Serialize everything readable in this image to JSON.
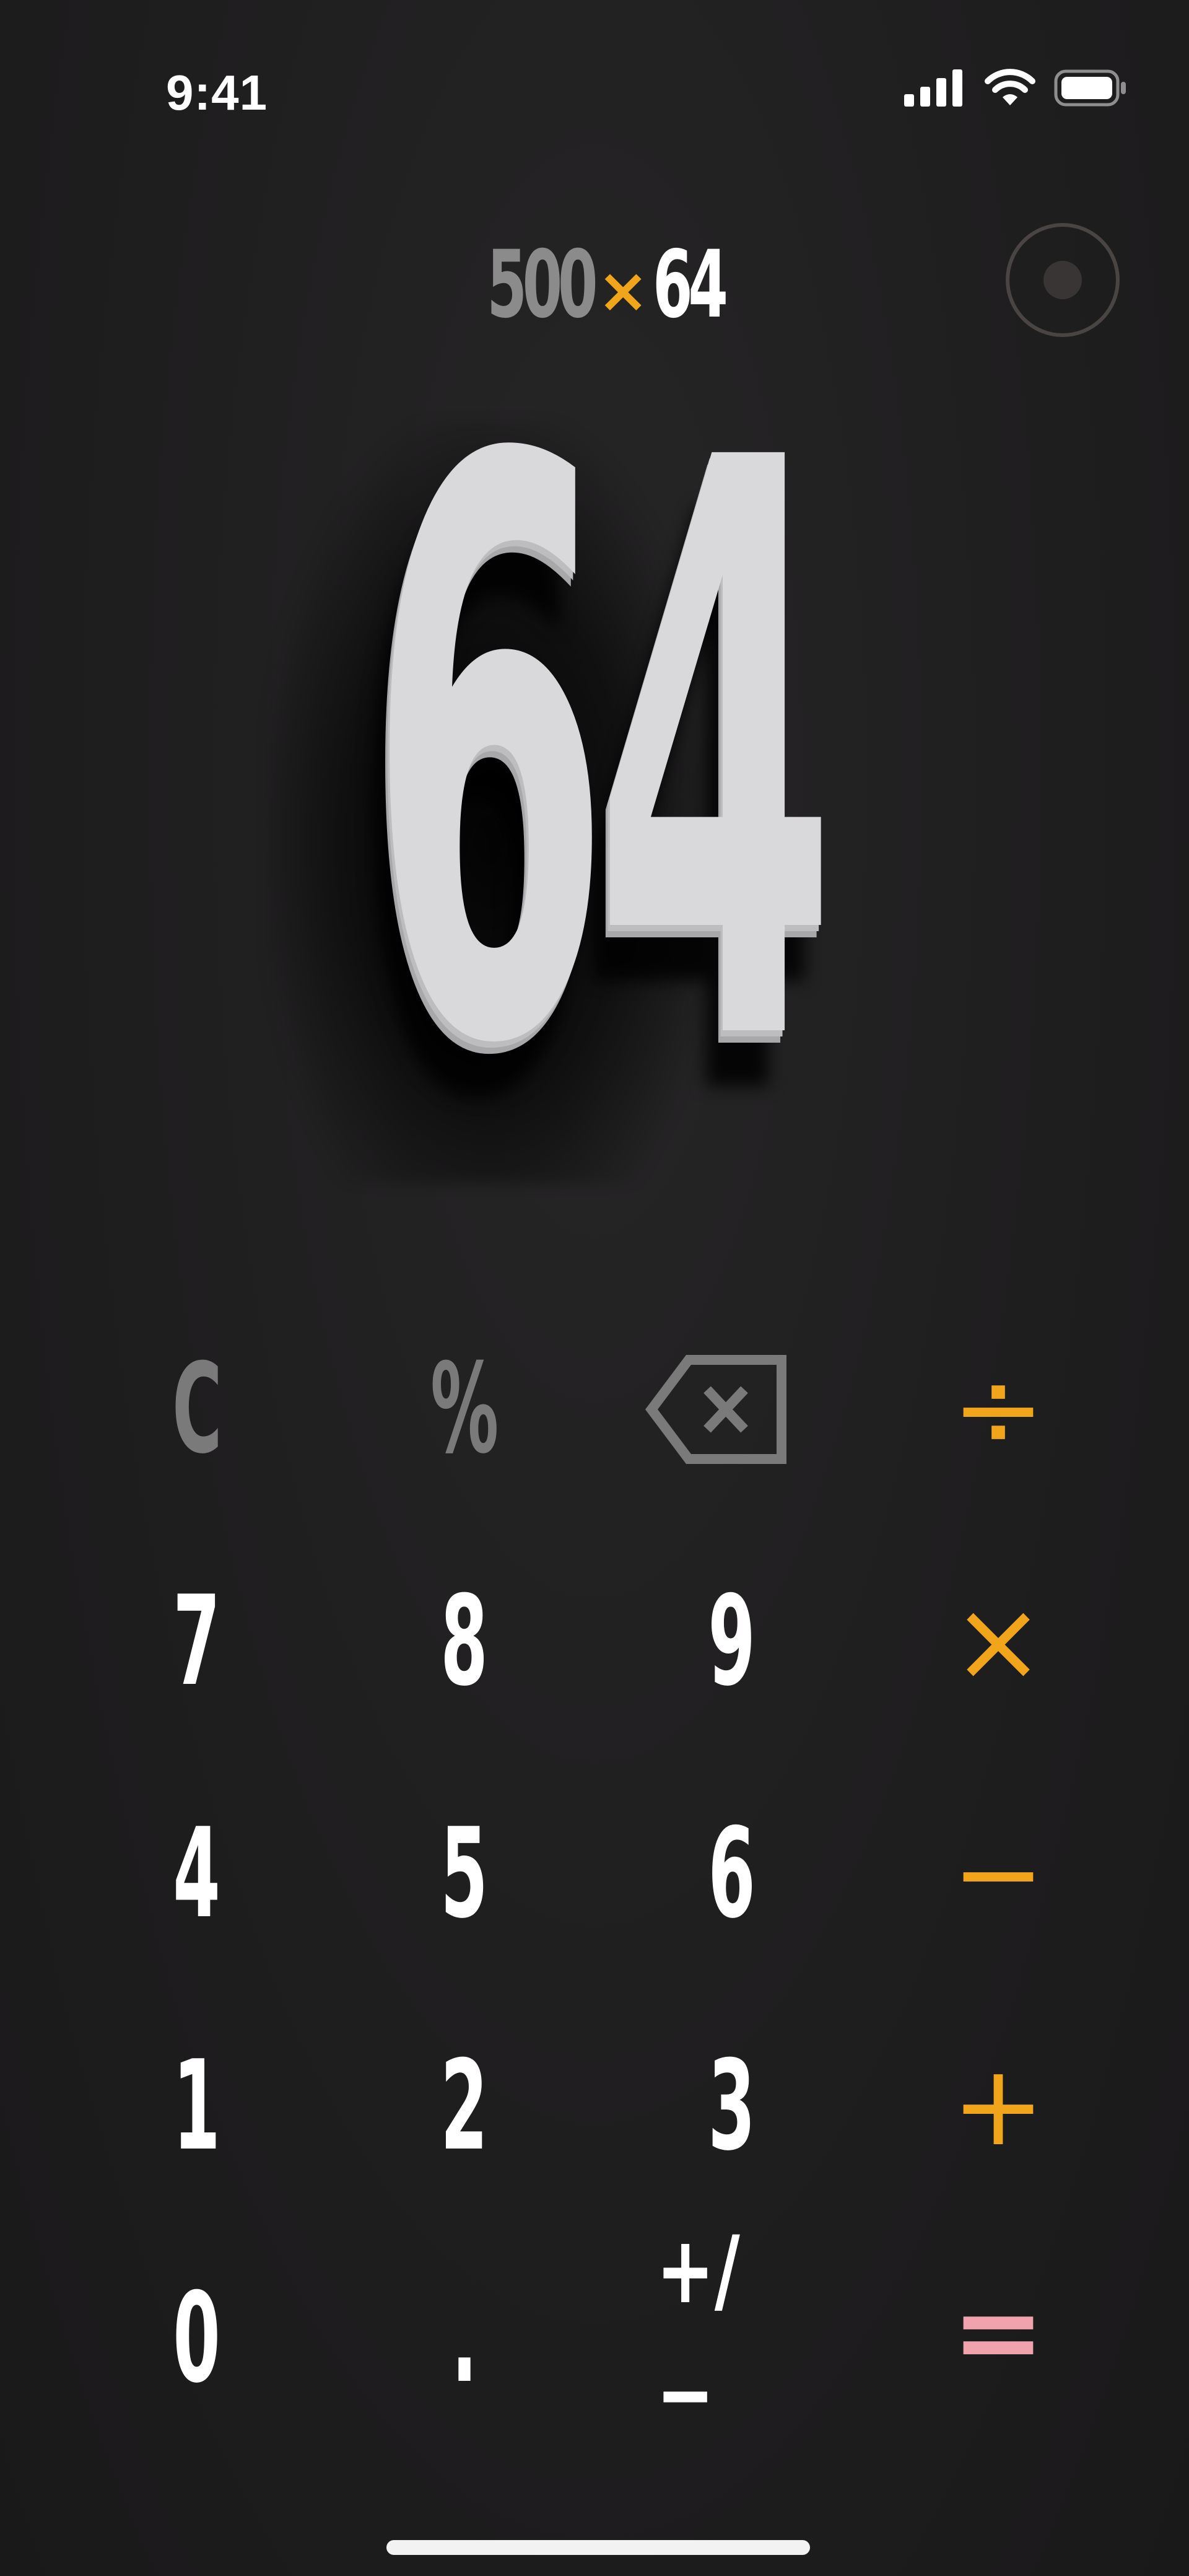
{
  "status_bar": {
    "time": "9:41"
  },
  "history": {
    "operand1": "500",
    "operator": "×",
    "operand2": "64"
  },
  "display": {
    "value": "64"
  },
  "keypad": {
    "clear": "C",
    "percent": "%",
    "divide": "÷",
    "multiply": "×",
    "subtract": "−",
    "add": "+",
    "equals": "=",
    "seven": "7",
    "eight": "8",
    "nine": "9",
    "four": "4",
    "five": "5",
    "six": "6",
    "one": "1",
    "two": "2",
    "three": "3",
    "zero": "0",
    "decimal": ".",
    "sign": "+/−"
  },
  "icons": {
    "signal": "cellular-signal-icon",
    "wifi": "wifi-icon",
    "battery": "battery-icon",
    "backspace": "backspace-icon",
    "record": "record-icon"
  },
  "colors": {
    "background": "#1d1c1d",
    "operator_accent": "#f0a51a",
    "equals_accent": "#f0a3ad",
    "function_gray": "#7b7a7b",
    "display_white": "#d9d8da"
  }
}
